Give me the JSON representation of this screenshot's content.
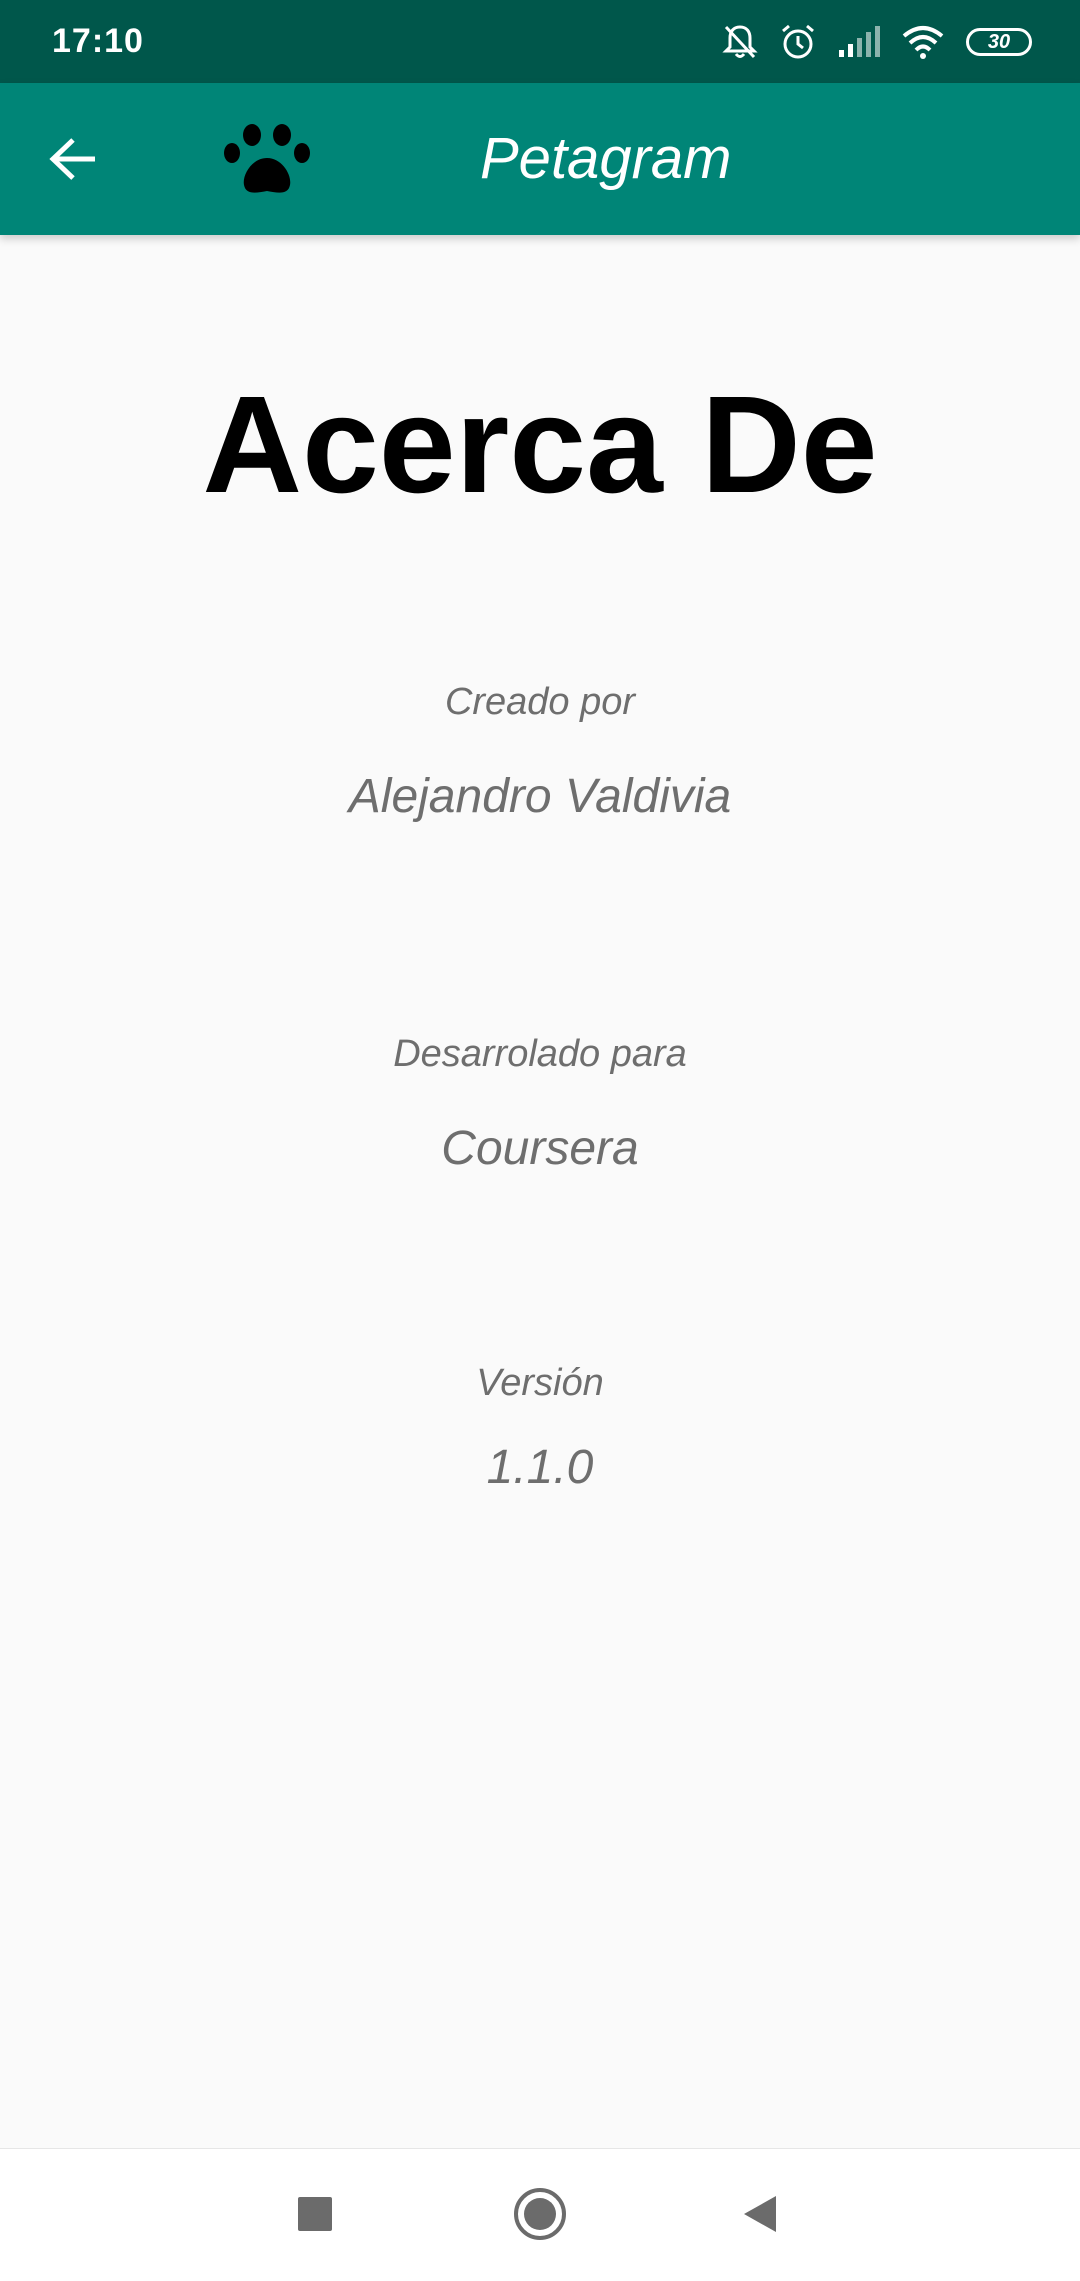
{
  "status_bar": {
    "time": "17:10",
    "icons": [
      "notifications-off-icon",
      "alarm-icon",
      "signal-icon",
      "wifi-icon",
      "battery-icon"
    ],
    "battery_level": "30"
  },
  "app_bar": {
    "title": "Petagram",
    "back_icon": "arrow-back-icon",
    "logo_icon": "paw-icon"
  },
  "content": {
    "title": "Acerca De",
    "created_by_label": "Creado por",
    "created_by_value": "Alejandro Valdivia",
    "developed_for_label": "Desarrolado para",
    "developed_for_value": "Coursera",
    "version_label": "Versión",
    "version_value": "1.1.0"
  },
  "nav_bar": {
    "icons": [
      "recents-square-icon",
      "home-circle-icon",
      "back-triangle-icon"
    ]
  },
  "colors": {
    "status_bar": "#00574b",
    "app_bar": "#008577",
    "background": "#fafafa",
    "secondary_text": "#6e6e6e"
  }
}
